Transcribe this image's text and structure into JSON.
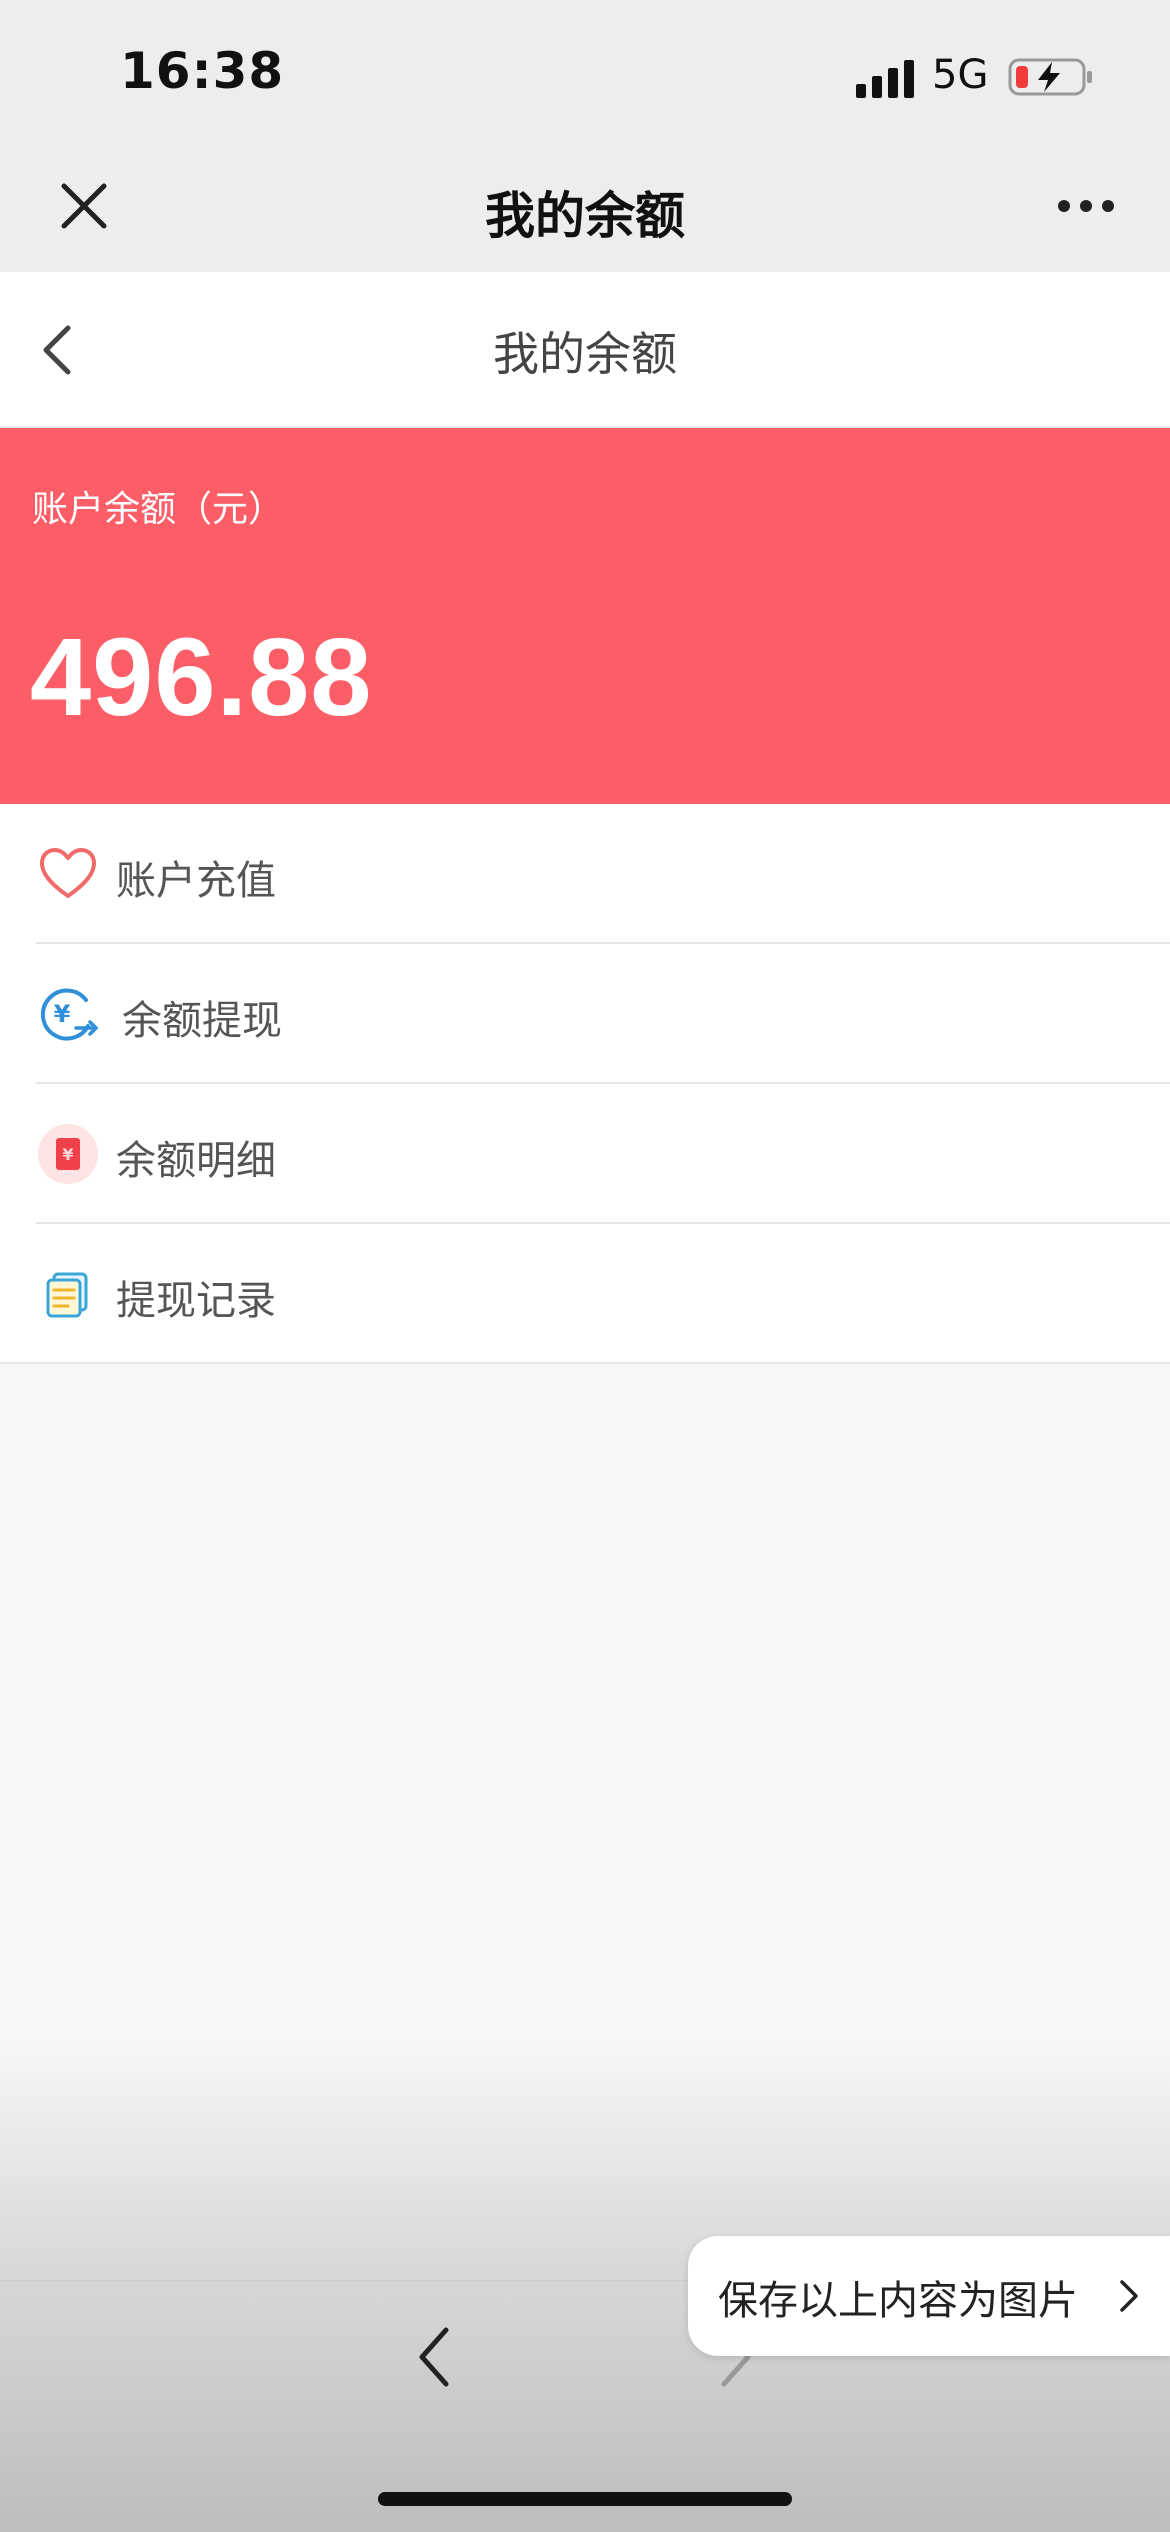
{
  "status_bar": {
    "time": "16:38",
    "network": "5G",
    "icons": [
      "signal-bars-icon",
      "battery-charging-icon"
    ]
  },
  "wechat_nav": {
    "title": "我的余额",
    "icons": [
      "close-icon",
      "more-icon"
    ]
  },
  "page_header": {
    "title": "我的余额",
    "icons": [
      "back-chevron-icon"
    ]
  },
  "balance": {
    "label": "账户余额（元）",
    "value": "496.88"
  },
  "menu": {
    "items": [
      {
        "label": "账户充值",
        "icon": "heart-icon"
      },
      {
        "label": "余额提现",
        "icon": "yuan-withdraw-icon"
      },
      {
        "label": "余额明细",
        "icon": "red-envelope-icon"
      },
      {
        "label": "提现记录",
        "icon": "records-icon"
      }
    ]
  },
  "bottom": {
    "save_label": "保存以上内容为图片",
    "icons": [
      "back-arrow-icon",
      "forward-arrow-icon",
      "chevron-right-icon"
    ]
  },
  "colors": {
    "banner": "#fc5e68",
    "nav_bg": "#ededed",
    "heart": "#f06a6a",
    "withdraw": "#2f8fd8",
    "envelope": "#f0404a",
    "records": "#3aa6d8"
  }
}
